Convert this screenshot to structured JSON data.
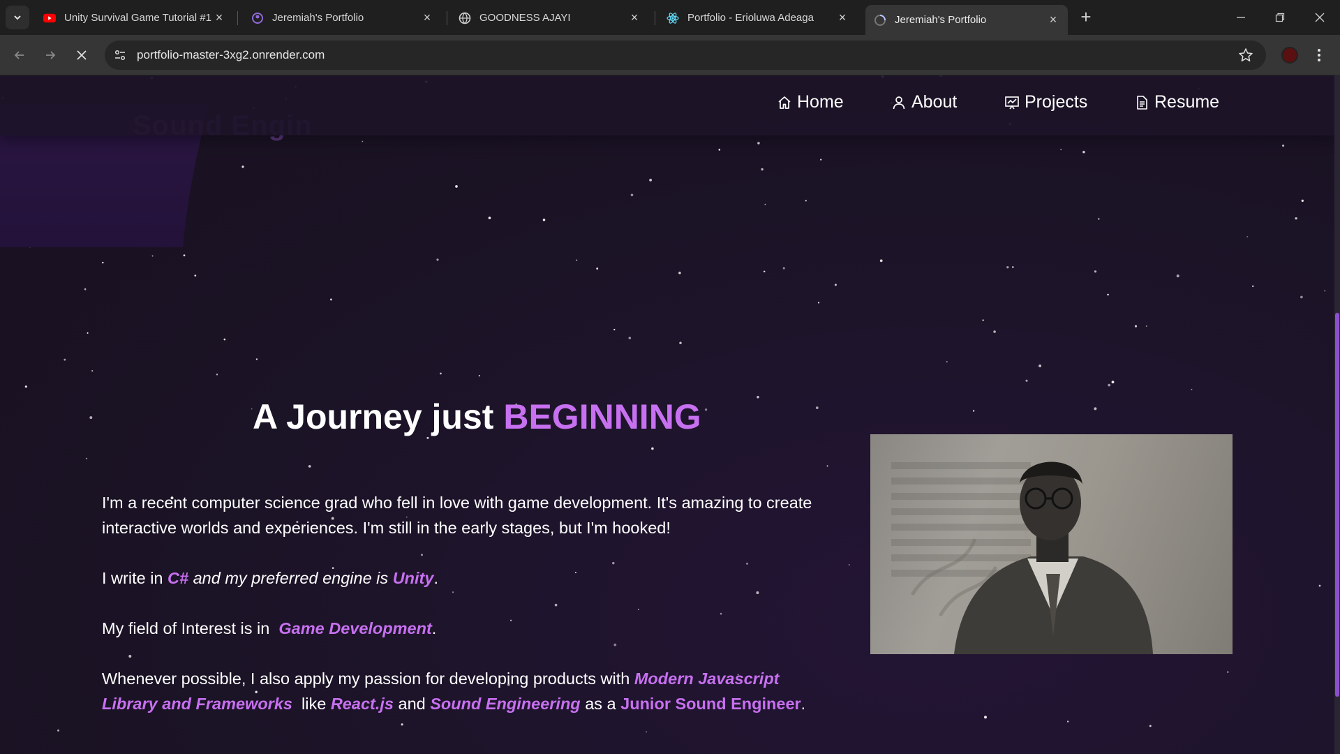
{
  "browser": {
    "tabs": [
      {
        "title": "Unity Survival Game Tutorial #1",
        "favicon": "youtube-icon",
        "active": false
      },
      {
        "title": "Jeremiah's Portfolio",
        "favicon": "portfolio-icon",
        "active": false
      },
      {
        "title": "GOODNESS AJAYI",
        "favicon": "globe-icon",
        "active": false
      },
      {
        "title": "Portfolio - Erioluwa Adeaga",
        "favicon": "react-icon",
        "active": false
      },
      {
        "title": "Jeremiah's Portfolio",
        "favicon": "loading-icon",
        "active": true
      }
    ],
    "url": "portfolio-master-3xg2.onrender.com",
    "colors": {
      "youtube": "#ff0000",
      "react": "#61dafb"
    }
  },
  "site": {
    "ghost_text": "Sound Engin",
    "nav": [
      {
        "label": "Home",
        "icon": "home-icon"
      },
      {
        "label": "About",
        "icon": "user-icon"
      },
      {
        "label": "Projects",
        "icon": "projects-icon"
      },
      {
        "label": "Resume",
        "icon": "document-icon"
      }
    ],
    "heading": {
      "prefix": "A Journey just",
      "accent": "BEGINNING"
    },
    "paragraphs": {
      "p1": "I'm a recent computer science grad who fell in love with game development. It's amazing to create interactive worlds and experiences. I'm still in the early stages, but I'm hooked!",
      "p2": {
        "a": "I write in ",
        "csharp": "C#",
        "b": " and my preferred engine is ",
        "unity": "Unity",
        "c": "."
      },
      "p3": {
        "a": "My field of Interest is in ",
        "field": "Game Development",
        "b": "."
      },
      "p4": {
        "a": "Whenever possible, I also apply my passion for developing products with ",
        "modern": "Modern Javascript Library and Frameworks",
        "b": "  like ",
        "react": "React.js",
        "c": " and ",
        "sound": "Sound Engineering",
        "d": " as a ",
        "junior": "Junior Sound Engineer",
        "e": "."
      }
    },
    "accent_color": "#c770f0"
  }
}
